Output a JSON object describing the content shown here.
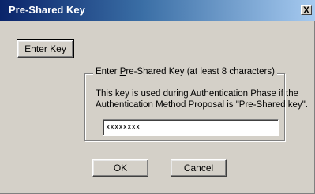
{
  "window": {
    "title": "Pre-Shared Key",
    "close_glyph": "X"
  },
  "buttons": {
    "enter_key": "Enter Key",
    "ok": "OK",
    "cancel": "Cancel"
  },
  "group": {
    "legend_prefix": "Enter ",
    "legend_underlined": "P",
    "legend_suffix": "re-Shared Key (at least 8 characters)",
    "description_line1": "This key is used during Authentication Phase if the",
    "description_line2": "Authentication Method Proposal is \"Pre-Shared key\"."
  },
  "key_input": {
    "value": "xxxxxxxx"
  },
  "colors": {
    "face": "#d4d0c8",
    "titlebar_start": "#0a246a",
    "titlebar_end": "#a6caf0"
  }
}
